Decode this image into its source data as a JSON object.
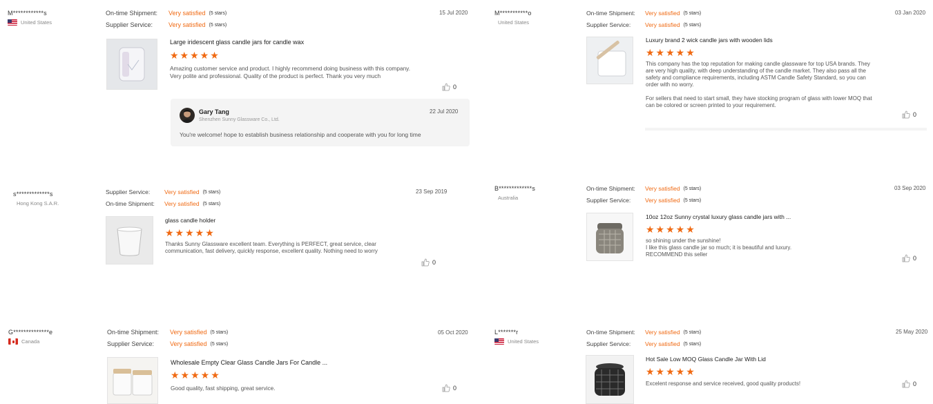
{
  "reviews": [
    {
      "user": "M************s",
      "country": "United States",
      "flag": "us",
      "ratings": [
        {
          "label": "On-time Shipment:",
          "value": "Very satisfied",
          "stars": "(5 stars)"
        },
        {
          "label": "Supplier Service:",
          "value": "Very satisfied",
          "stars": "(5 stars)"
        }
      ],
      "date": "15 Jul 2020",
      "product_title": "Large iridescent glass candle jars for candle wax",
      "stars": "★★★★★",
      "body": [
        "Amazing customer service and product. I highly recommend doing business with this company. Very polite and professional. Quality of the product is perfect. Thank you very much"
      ],
      "likes": "0",
      "reply": {
        "name": "Gary Tang",
        "company": "Shenzhen Sunny Glassware Co., Ltd.",
        "date": "22 Jul 2020",
        "text": "You're welcome! hope to establish business relationship and cooperate with you for long time"
      }
    },
    {
      "user": "M***********o",
      "country": "United States",
      "flag": "",
      "ratings": [
        {
          "label": "On-time Shipment:",
          "value": "Very satisfied",
          "stars": "(5 stars)"
        },
        {
          "label": "Supplier Service:",
          "value": "Very satisfied",
          "stars": "(5 stars)"
        }
      ],
      "date": "03 Jan 2020",
      "product_title": "Luxury brand 2 wick candle jars with wooden lids",
      "stars": "★★★★★",
      "body": [
        "This company has the top reputation for making candle glassware for top USA brands. They are very high quality, with deep understanding of the candle market. They also pass all the safety and compliance requirements, including ASTM Candle Safety Standard, so you can order with no worry.",
        "For sellers that need to start small, they have stocking program of glass with lower MOQ that can be colored or screen printed to your requirement."
      ],
      "likes": "0"
    },
    {
      "user": "s*************s",
      "country": "Hong Kong S.A.R.",
      "flag": "",
      "ratings": [
        {
          "label": "Supplier Service:",
          "value": "Very satisfied",
          "stars": "(5 stars)"
        },
        {
          "label": "On-time Shipment:",
          "value": "Very satisfied",
          "stars": "(5 stars)"
        }
      ],
      "date": "23 Sep 2019",
      "product_title": "glass candle holder",
      "stars": "★★★★★",
      "body": [
        "Thanks Sunny Glassware excellent team. Everything is PERFECT, great service, clear communication, fast delivery, quickly response, excellent quality. Nothing need to worry"
      ],
      "likes": "0"
    },
    {
      "user": "B*************s",
      "country": "Australia",
      "flag": "",
      "ratings": [
        {
          "label": "On-time Shipment:",
          "value": "Very satisfied",
          "stars": "(5 stars)"
        },
        {
          "label": "Supplier Service:",
          "value": "Very satisfied",
          "stars": "(5 stars)"
        }
      ],
      "date": "03 Sep 2020",
      "product_title": "10oz 12oz Sunny crystal luxury glass candle jars with ...",
      "stars": "★★★★★",
      "body": [
        "so shining under the sunshine!\nI like this glass candle jar so much; it is beautiful and luxury.\nRECOMMEND this seller"
      ],
      "likes": "0"
    },
    {
      "user": "G**************e",
      "country": "Canada",
      "flag": "ca",
      "ratings": [
        {
          "label": "On-time Shipment:",
          "value": "Very satisfied",
          "stars": "(5 stars)"
        },
        {
          "label": "Supplier Service:",
          "value": "Very satisfied",
          "stars": "(5 stars)"
        }
      ],
      "date": "05 Oct 2020",
      "product_title": "Wholesale Empty Clear Glass Candle Jars For Candle ...",
      "stars": "★★★★★",
      "body": [
        "Good quality, fast shipping, great service."
      ],
      "likes": "0"
    },
    {
      "user": "L*******r",
      "country": "United States",
      "flag": "us",
      "ratings": [
        {
          "label": "On-time Shipment:",
          "value": "Very satisfied",
          "stars": "(5 stars)"
        },
        {
          "label": "Supplier Service:",
          "value": "Very satisfied",
          "stars": "(5 stars)"
        }
      ],
      "date": "25 May 2020",
      "product_title": "Hot Sale Low MOQ Glass Candle Jar With Lid",
      "stars": "★★★★★",
      "body": [
        "Excelent response and service received, good quality products!"
      ],
      "likes": "0"
    }
  ]
}
